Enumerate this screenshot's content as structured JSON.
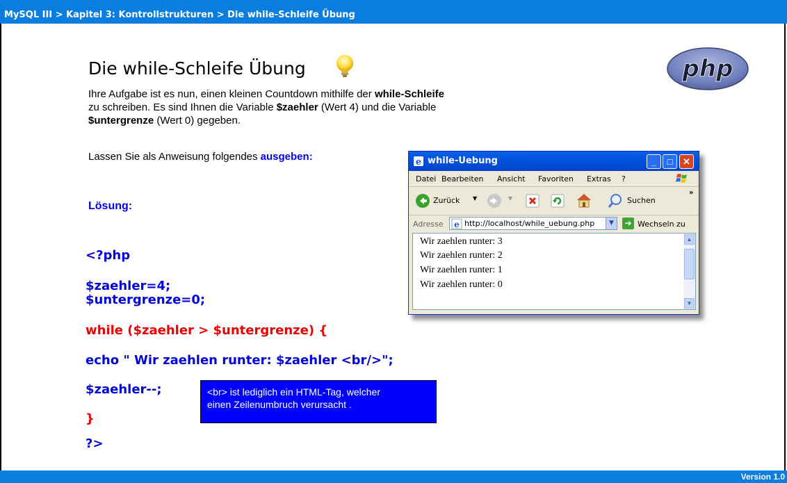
{
  "header": {
    "breadcrumb": "MySQL III > Kapitel 3: Kontrollstrukturen > Die while-Schleife Übung"
  },
  "footer": {
    "version": "Version 1.0"
  },
  "slide": {
    "title": "Die while-Schleife Übung",
    "intro": {
      "t1": "Ihre Aufgabe ist es nun, einen kleinen Countdown mithilfe der ",
      "b1": "while-Schleife",
      "t2": "zu schreiben. Es sind Ihnen die Variable ",
      "b2": "$zaehler",
      "t3": " (Wert 4) und die Variable",
      "b3": "$untergrenze",
      "t4": " (Wert 0) gegeben."
    },
    "instruction": {
      "text": "Lassen Sie als Anweisung folgendes ",
      "highlight": "ausgeben:"
    },
    "solution_label": "Lösung:",
    "code": [
      {
        "text": "<?php",
        "color": "blue"
      },
      {
        "text": "$zaehler=4;",
        "color": "blue"
      },
      {
        "text": "$untergrenze=0;",
        "color": "blue"
      },
      {
        "text": "while ($zaehler > $untergrenze) {",
        "color": "red"
      },
      {
        "text": "echo \" Wir zaehlen runter: $zaehler <br/>\";",
        "color": "blue"
      },
      {
        "text": "$zaehler--;",
        "color": "blue"
      },
      {
        "text": "}",
        "color": "red"
      },
      {
        "text": "?>",
        "color": "blue"
      }
    ],
    "tooltip": {
      "line1": "<br> ist lediglich ein HTML-Tag, welcher",
      "line2": "einen Zeilenumbruch verursacht ."
    },
    "logo_text": "php"
  },
  "browser": {
    "title": "while-Uebung",
    "menu": [
      "Datei",
      "Bearbeiten",
      "Ansicht",
      "Favoriten",
      "Extras",
      "?"
    ],
    "toolbar": {
      "back": "Zurück",
      "search": "Suchen"
    },
    "address_label": "Adresse",
    "url": "http://localhost/while_uebung.php",
    "go_label": "Wechseln zu",
    "output": [
      "Wir zaehlen runter: 3",
      "Wir zaehlen runter: 2",
      "Wir zaehlen runter: 1",
      "Wir zaehlen runter: 0"
    ]
  },
  "colors": {
    "bar": "#0a7ee0",
    "code_blue": "#0000dd",
    "code_red": "#ee0000",
    "tooltip_bg": "#0000ff",
    "xp_title": "#0054e3"
  }
}
